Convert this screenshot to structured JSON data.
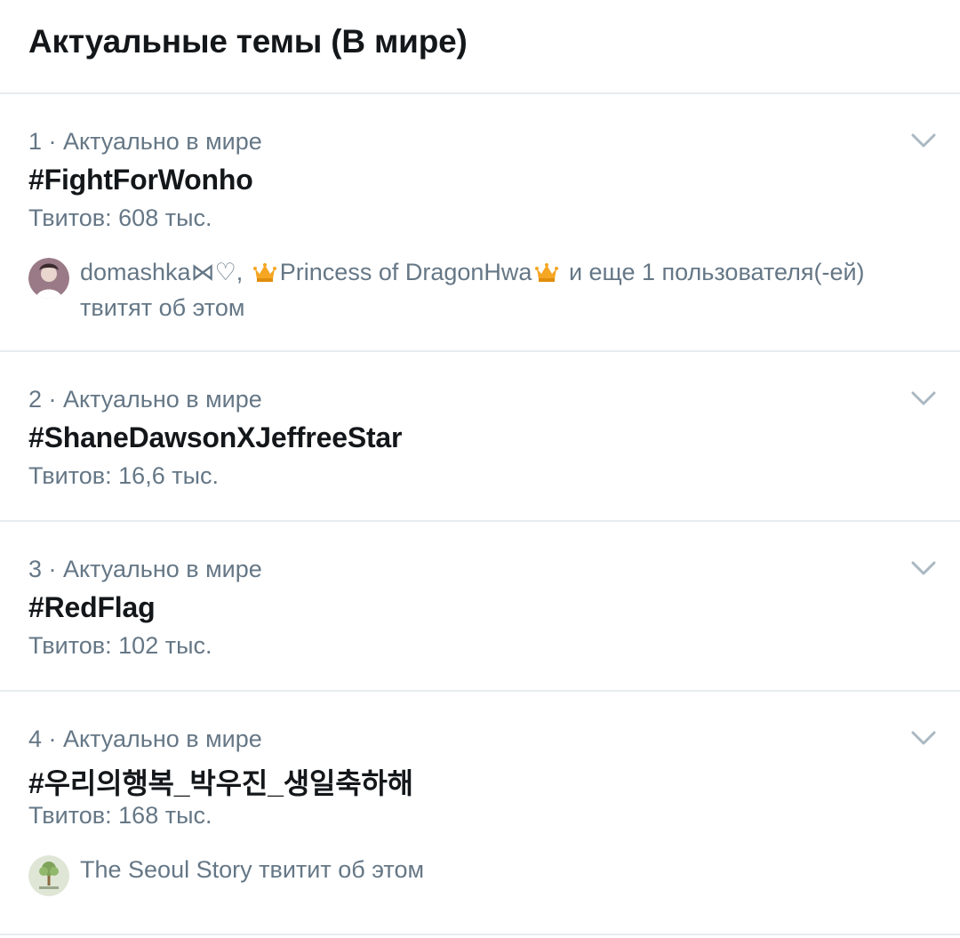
{
  "header": {
    "title": "Актуальные темы (В мире)"
  },
  "trends": [
    {
      "meta": "1 · Актуально в мире",
      "topic": "#FightForWonho",
      "count": "Твитов: 608 тыс.",
      "social": {
        "user1": "domashka⋈♡,",
        "user2": "Princess of DragonHwa",
        "rest": "и еще 1 пользователя(-ей) твитят об этом"
      }
    },
    {
      "meta": "2 · Актуально в мире",
      "topic": "#ShaneDawsonXJeffreeStar",
      "count": "Твитов: 16,6 тыс."
    },
    {
      "meta": "3 · Актуально в мире",
      "topic": "#RedFlag",
      "count": "Твитов: 102 тыс."
    },
    {
      "meta": "4 · Актуально в мире",
      "topic": "#우리의행복_박우진_생일축하해",
      "count": "Твитов: 168 тыс.",
      "social": {
        "text": "The Seoul Story твитит об этом"
      }
    }
  ],
  "colors": {
    "primary_text": "#14171a",
    "secondary_text": "#657786",
    "divider": "#e6ecf0",
    "chevron": "#aab8c2",
    "crown": "#f5a623"
  },
  "icons": {
    "chevron": "chevron-down-icon",
    "crown": "crown-icon",
    "avatar": "avatar"
  }
}
